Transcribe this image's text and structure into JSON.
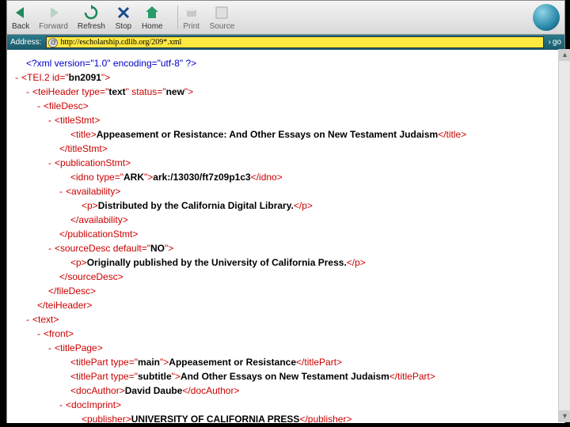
{
  "toolbar": {
    "back": "Back",
    "forward": "Forward",
    "refresh": "Refresh",
    "stop": "Stop",
    "home": "Home",
    "print": "Print",
    "source": "Source"
  },
  "address": {
    "label": "Address:",
    "url": "http://escholarship.cdlib.org/209*.xml",
    "go": "go"
  },
  "xml": {
    "decl": "<?xml version=\"1.0\" encoding=\"utf-8\" ?>",
    "tei_open": "<TEI.2 id=\"",
    "tei_id": "bn2091",
    "teiheader_open": "<teiHeader type=\"",
    "teiheader_type": "text",
    "teiheader_status": "new",
    "filedesc": "fileDesc",
    "titlestmt": "titleStmt",
    "title": "title",
    "title_text": "Appeasement or Resistance: And Other Essays on New Testament Judaism",
    "pubstmt": "publicationStmt",
    "idno": "idno",
    "idno_type": "ARK",
    "idno_text": "ark:/13030/ft7z09p1c3",
    "availability": "availability",
    "p": "p",
    "avail_text": "Distributed by the California Digital Library.",
    "sourcedesc": "sourceDesc",
    "sourcedesc_default": "NO",
    "source_text": "Originally published by the University of California Press.",
    "teiheader_close": "teiHeader",
    "text": "text",
    "front": "front",
    "titlepage": "titlePage",
    "titlepart": "titlePart",
    "tp_main": "main",
    "tp_main_text": "Appeasement or Resistance",
    "tp_sub": "subtitle",
    "tp_sub_text": "And Other Essays on New Testament Judaism",
    "docauthor": "docAuthor",
    "author_text": "David Daube",
    "docimprint": "docImprint",
    "publisher": "publisher",
    "publisher_text": "UNIVERSITY OF CALIFORNIA PRESS"
  }
}
